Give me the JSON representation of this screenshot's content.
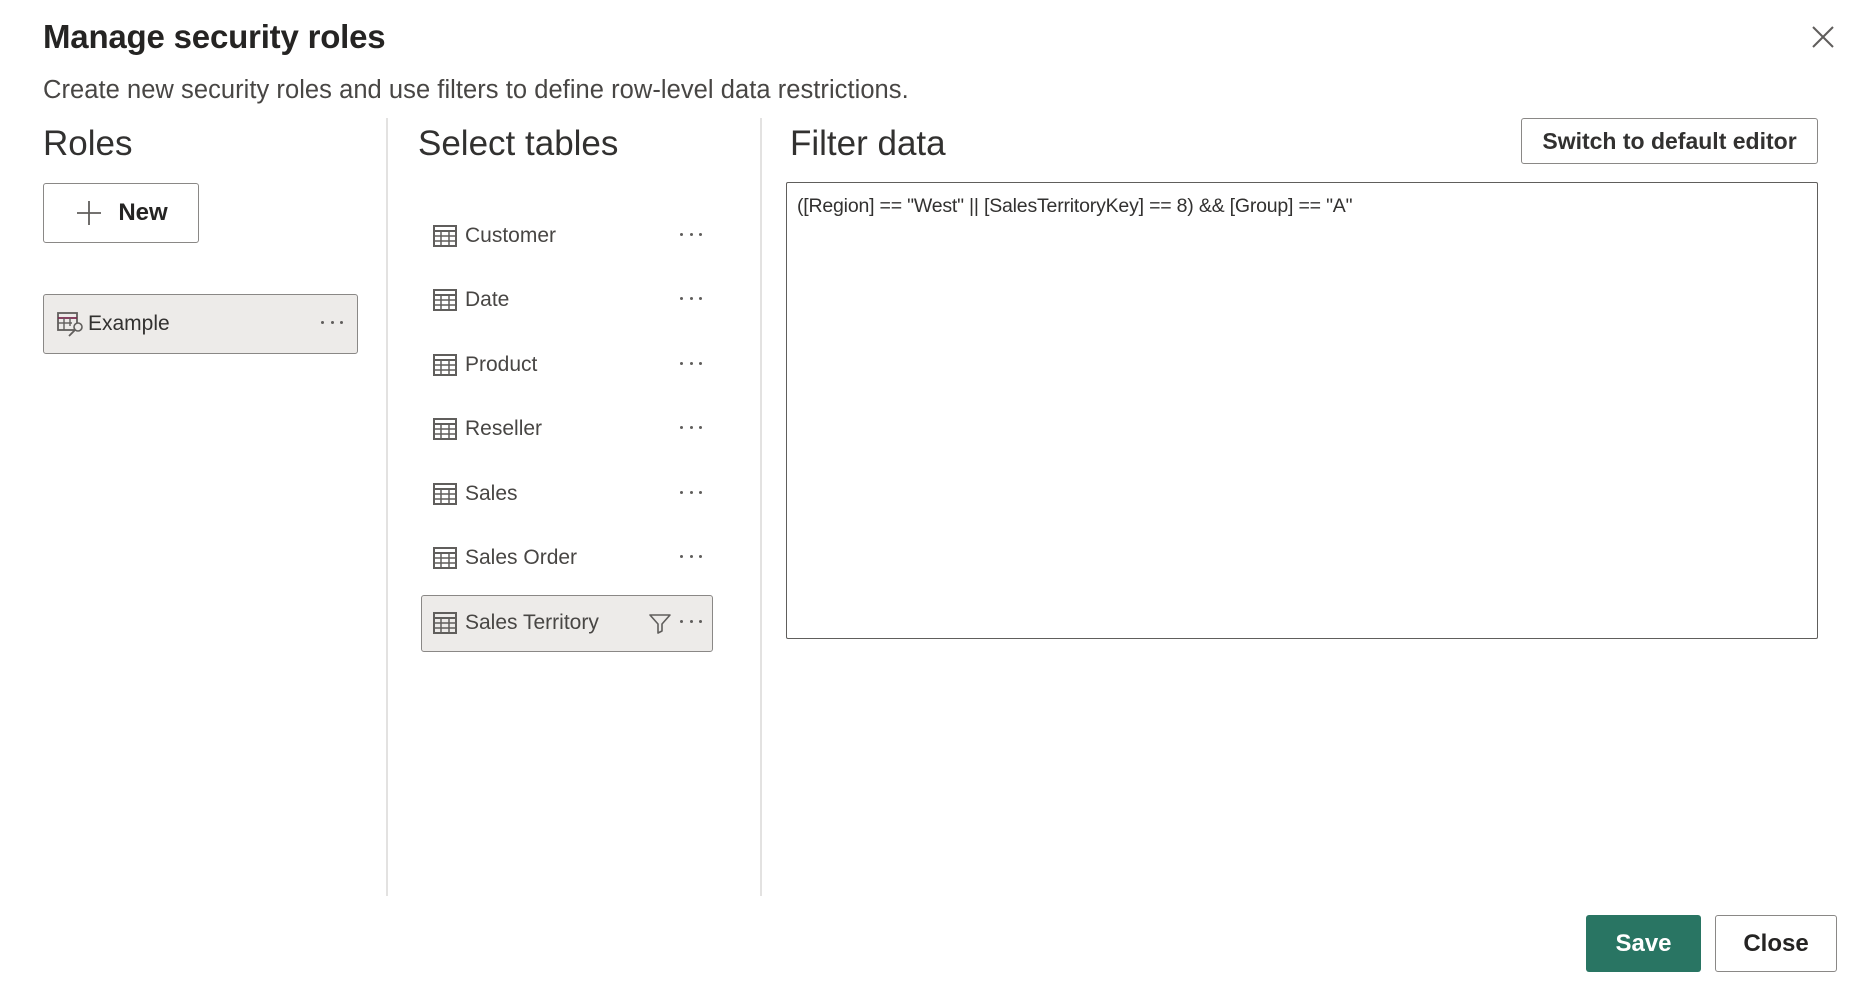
{
  "dialog": {
    "title": "Manage security roles",
    "subtitle": "Create new security roles and use filters to define row-level data restrictions.",
    "close_icon": "close-icon"
  },
  "roles": {
    "heading": "Roles",
    "new_button_label": "New",
    "new_button_icon": "plus-icon",
    "items": [
      {
        "label": "Example",
        "icon": "table-key-icon",
        "selected": true
      }
    ]
  },
  "tables": {
    "heading": "Select tables",
    "items": [
      {
        "label": "Customer",
        "icon": "table-icon",
        "has_filter": false,
        "selected": false
      },
      {
        "label": "Date",
        "icon": "table-icon",
        "has_filter": false,
        "selected": false
      },
      {
        "label": "Product",
        "icon": "table-icon",
        "has_filter": false,
        "selected": false
      },
      {
        "label": "Reseller",
        "icon": "table-icon",
        "has_filter": false,
        "selected": false
      },
      {
        "label": "Sales",
        "icon": "table-icon",
        "has_filter": false,
        "selected": false
      },
      {
        "label": "Sales Order",
        "icon": "table-icon",
        "has_filter": false,
        "selected": false
      },
      {
        "label": "Sales Territory",
        "icon": "table-icon",
        "has_filter": true,
        "selected": true
      }
    ]
  },
  "filter": {
    "heading": "Filter data",
    "switch_button_label": "Switch to default editor",
    "expression": "([Region] == \"West\" || [SalesTerritoryKey] == 8) && [Group] == \"A\""
  },
  "footer": {
    "save_label": "Save",
    "close_label": "Close"
  },
  "colors": {
    "primary": "#297563",
    "selected_bg": "#edebe9",
    "border": "#8a8886"
  }
}
